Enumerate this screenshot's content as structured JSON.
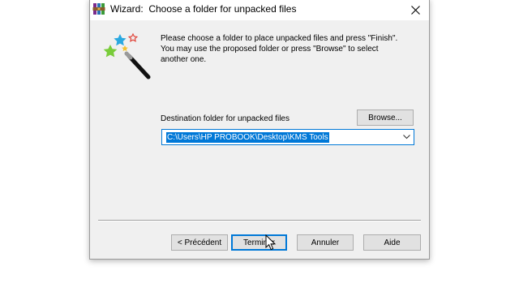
{
  "window": {
    "title": "Wizard:  Choose a folder for unpacked files",
    "app_icon": "winrar-icon",
    "close_icon": "close-icon"
  },
  "wizard_icon": "magic-wand-icon",
  "instruction_text": "Please choose a folder to place unpacked files and press \"Finish\".\nYou may use the proposed folder or press \"Browse\" to select\nanother one.",
  "destination": {
    "label": "Destination folder for unpacked files",
    "value": "C:\\Users\\HP PROBOOK\\Desktop\\KMS Tools",
    "browse_label": "Browse..."
  },
  "buttons": {
    "previous_label": "< Précédent",
    "finish_label": "Terminer",
    "cancel_label": "Annuler",
    "help_label": "Aide"
  },
  "colors": {
    "accent": "#0078d7",
    "dialog_bg": "#f0f0f0",
    "button_bg": "#e1e1e1"
  }
}
